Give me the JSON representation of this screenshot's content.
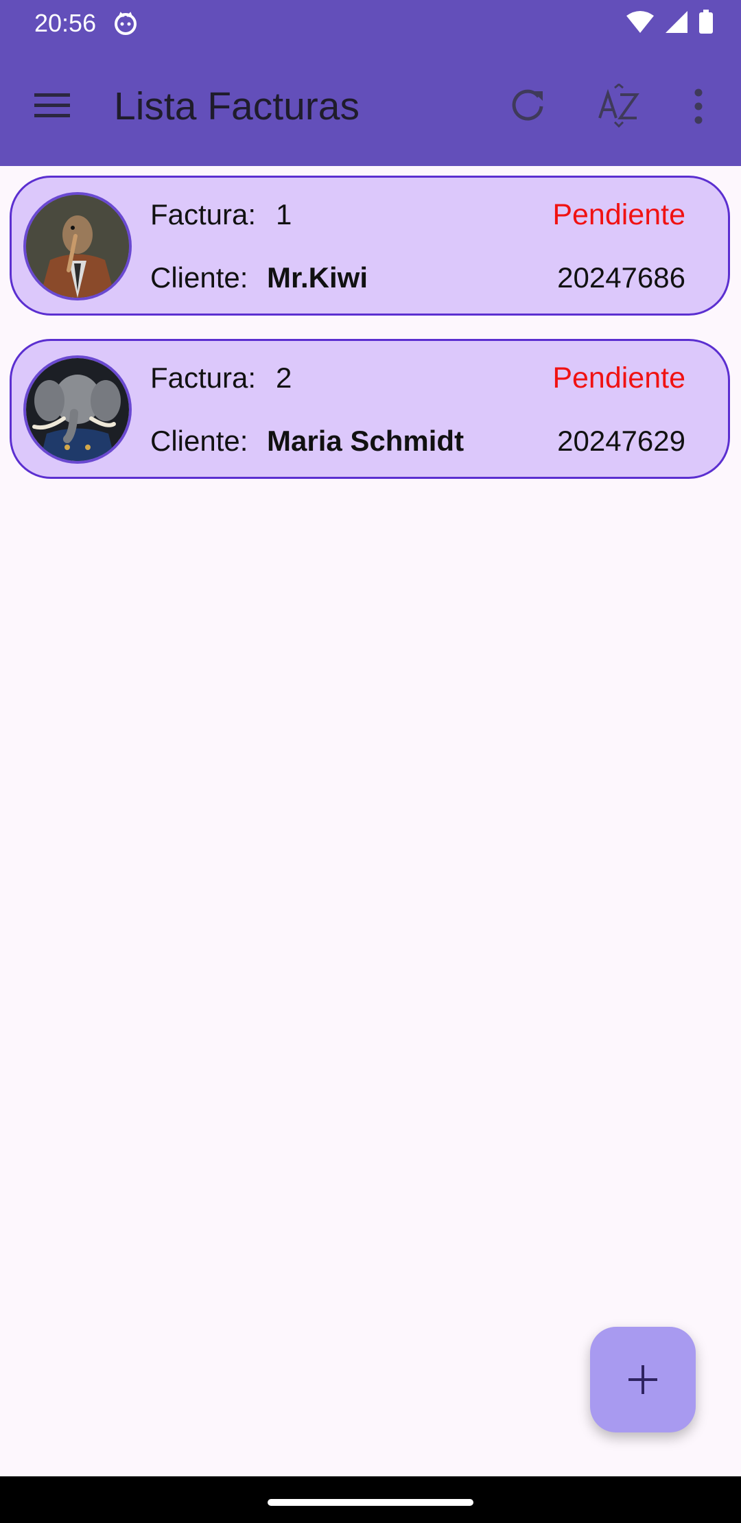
{
  "status_bar": {
    "time": "20:56"
  },
  "app_bar": {
    "title": "Lista Facturas",
    "icons": [
      "menu-icon",
      "refresh-icon",
      "sort-az-icon",
      "more-vert-icon"
    ]
  },
  "invoices": [
    {
      "invoice_label": "Factura:",
      "invoice_number": "1",
      "client_label": "Cliente:",
      "client_name": "Mr.Kiwi",
      "status": "Pendiente",
      "date": "20247686",
      "avatar_icon": "kiwi-portrait-avatar"
    },
    {
      "invoice_label": "Factura:",
      "invoice_number": "2",
      "client_label": "Cliente:",
      "client_name": "Maria Schmidt",
      "status": "Pendiente",
      "date": "20247629",
      "avatar_icon": "elephant-portrait-avatar"
    }
  ],
  "fab": {
    "icon": "plus-icon"
  },
  "colors": {
    "primary": "#634fba",
    "card_bg": "#dcc8fb",
    "card_border": "#5b2fd0",
    "status_pending": "#f01212",
    "fab_bg": "#a89af0"
  }
}
